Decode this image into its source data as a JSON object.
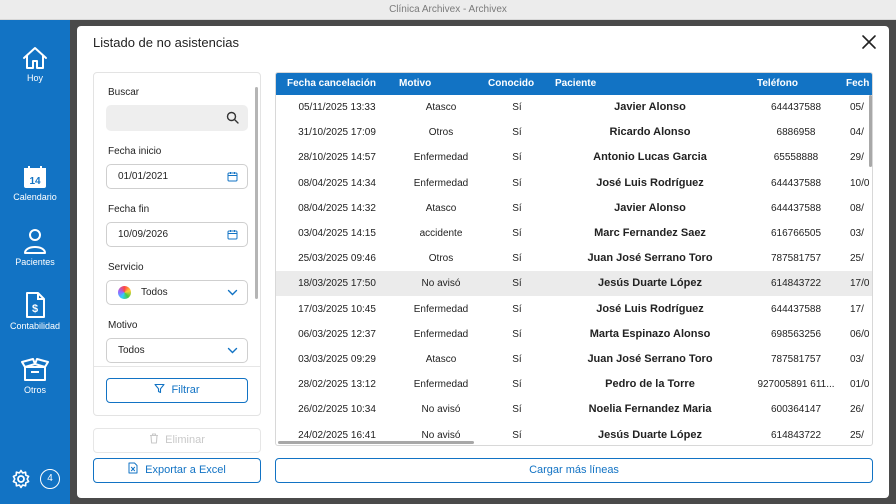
{
  "window_title": "Clínica Archivex - Archivex",
  "sidebar": {
    "items": [
      {
        "label": "Hoy",
        "icon": "home-icon"
      },
      {
        "label": "Calendario",
        "icon": "calendar-icon",
        "day": "14"
      },
      {
        "label": "Pacientes",
        "icon": "person-icon"
      },
      {
        "label": "Contabilidad",
        "icon": "invoice-icon"
      },
      {
        "label": "Otros",
        "icon": "box-icon"
      }
    ],
    "badge": "4"
  },
  "modal": {
    "title": "Listado de no asistencias"
  },
  "filters": {
    "search_label": "Buscar",
    "search_value": "",
    "start_label": "Fecha inicio",
    "start_value": "01/01/2021",
    "end_label": "Fecha fin",
    "end_value": "10/09/2026",
    "service_label": "Servicio",
    "service_value": "Todos",
    "reason_label": "Motivo",
    "reason_value": "Todos",
    "filter_button": "Filtrar",
    "delete_button": "Eliminar",
    "export_button": "Exportar a Excel"
  },
  "table": {
    "columns": [
      "Fecha cancelación",
      "Motivo",
      "Conocido",
      "Paciente",
      "Teléfono",
      "Fech"
    ],
    "rows": [
      [
        "05/11/2025 13:33",
        "Atasco",
        "Sí",
        "Javier Alonso",
        "644437588",
        "05/"
      ],
      [
        "31/10/2025 17:09",
        "Otros",
        "Sí",
        "Ricardo Alonso",
        "6886958",
        "04/"
      ],
      [
        "28/10/2025 14:57",
        "Enfermedad",
        "Sí",
        "Antonio Lucas Garcia",
        "65558888",
        "29/"
      ],
      [
        "08/04/2025 14:34",
        "Enfermedad",
        "Sí",
        "José Luis Rodríguez",
        "644437588",
        "10/0"
      ],
      [
        "08/04/2025 14:32",
        "Atasco",
        "Sí",
        "Javier Alonso",
        "644437588",
        "08/"
      ],
      [
        "03/04/2025 14:15",
        "accidente",
        "Sí",
        "Marc Fernandez Saez",
        "616766505",
        "03/"
      ],
      [
        "25/03/2025 09:46",
        "Otros",
        "Sí",
        "Juan José Serrano Toro",
        "787581757",
        "25/"
      ],
      [
        "18/03/2025 17:50",
        "No avisó",
        "Sí",
        "Jesús Duarte López",
        "614843722",
        "17/0"
      ],
      [
        "17/03/2025 10:45",
        "Enfermedad",
        "Sí",
        "José Luis Rodríguez",
        "644437588",
        "17/"
      ],
      [
        "06/03/2025 12:37",
        "Enfermedad",
        "Sí",
        "Marta Espinazo Alonso",
        "698563256",
        "06/0"
      ],
      [
        "03/03/2025 09:29",
        "Atasco",
        "Sí",
        "Juan José Serrano Toro",
        "787581757",
        "03/"
      ],
      [
        "28/02/2025 13:12",
        "Enfermedad",
        "Sí",
        "Pedro de la Torre",
        "927005891 611...",
        "01/0"
      ],
      [
        "26/02/2025 10:34",
        "No avisó",
        "Sí",
        "Noelia Fernandez Maria",
        "600364147",
        "26/"
      ],
      [
        "24/02/2025 16:41",
        "No avisó",
        "Sí",
        "Jesús Duarte López",
        "614843722",
        "25/"
      ]
    ],
    "highlighted_row": 7,
    "load_more_button": "Cargar más líneas"
  },
  "colors": {
    "primary": "#1273c4",
    "highlight": "#ebebeb"
  }
}
